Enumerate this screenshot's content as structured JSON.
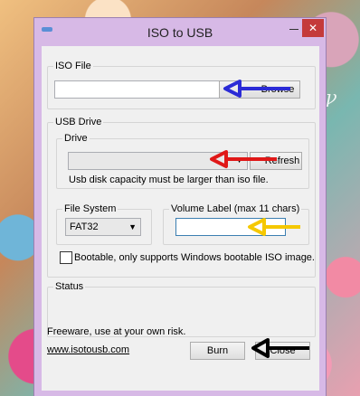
{
  "window": {
    "title": "ISO to USB",
    "close_glyph": "✕"
  },
  "iso_file": {
    "legend": "ISO File",
    "path_value": "",
    "browse_label": "Browse"
  },
  "usb_drive": {
    "legend": "USB Drive",
    "drive": {
      "legend": "Drive",
      "selected": "",
      "refresh_label": "Refresh",
      "note": "Usb disk capacity must be larger than iso file."
    },
    "file_system": {
      "legend": "File System",
      "selected": "FAT32"
    },
    "volume_label": {
      "legend": "Volume Label (max 11 chars)",
      "value": ""
    }
  },
  "bootable": {
    "label": "Bootable, only supports Windows bootable ISO image.",
    "checked": false
  },
  "status": {
    "legend": "Status",
    "text": ""
  },
  "footer": {
    "note": "Freeware, use at your own risk.",
    "link": "www.isotousb.com",
    "burn_label": "Burn",
    "close_label": "Close"
  },
  "annotations": {
    "arrow_colors": {
      "browse": "#2b2bd6",
      "refresh": "#e01818",
      "volume_label": "#f5c800",
      "close": "#000000"
    }
  }
}
